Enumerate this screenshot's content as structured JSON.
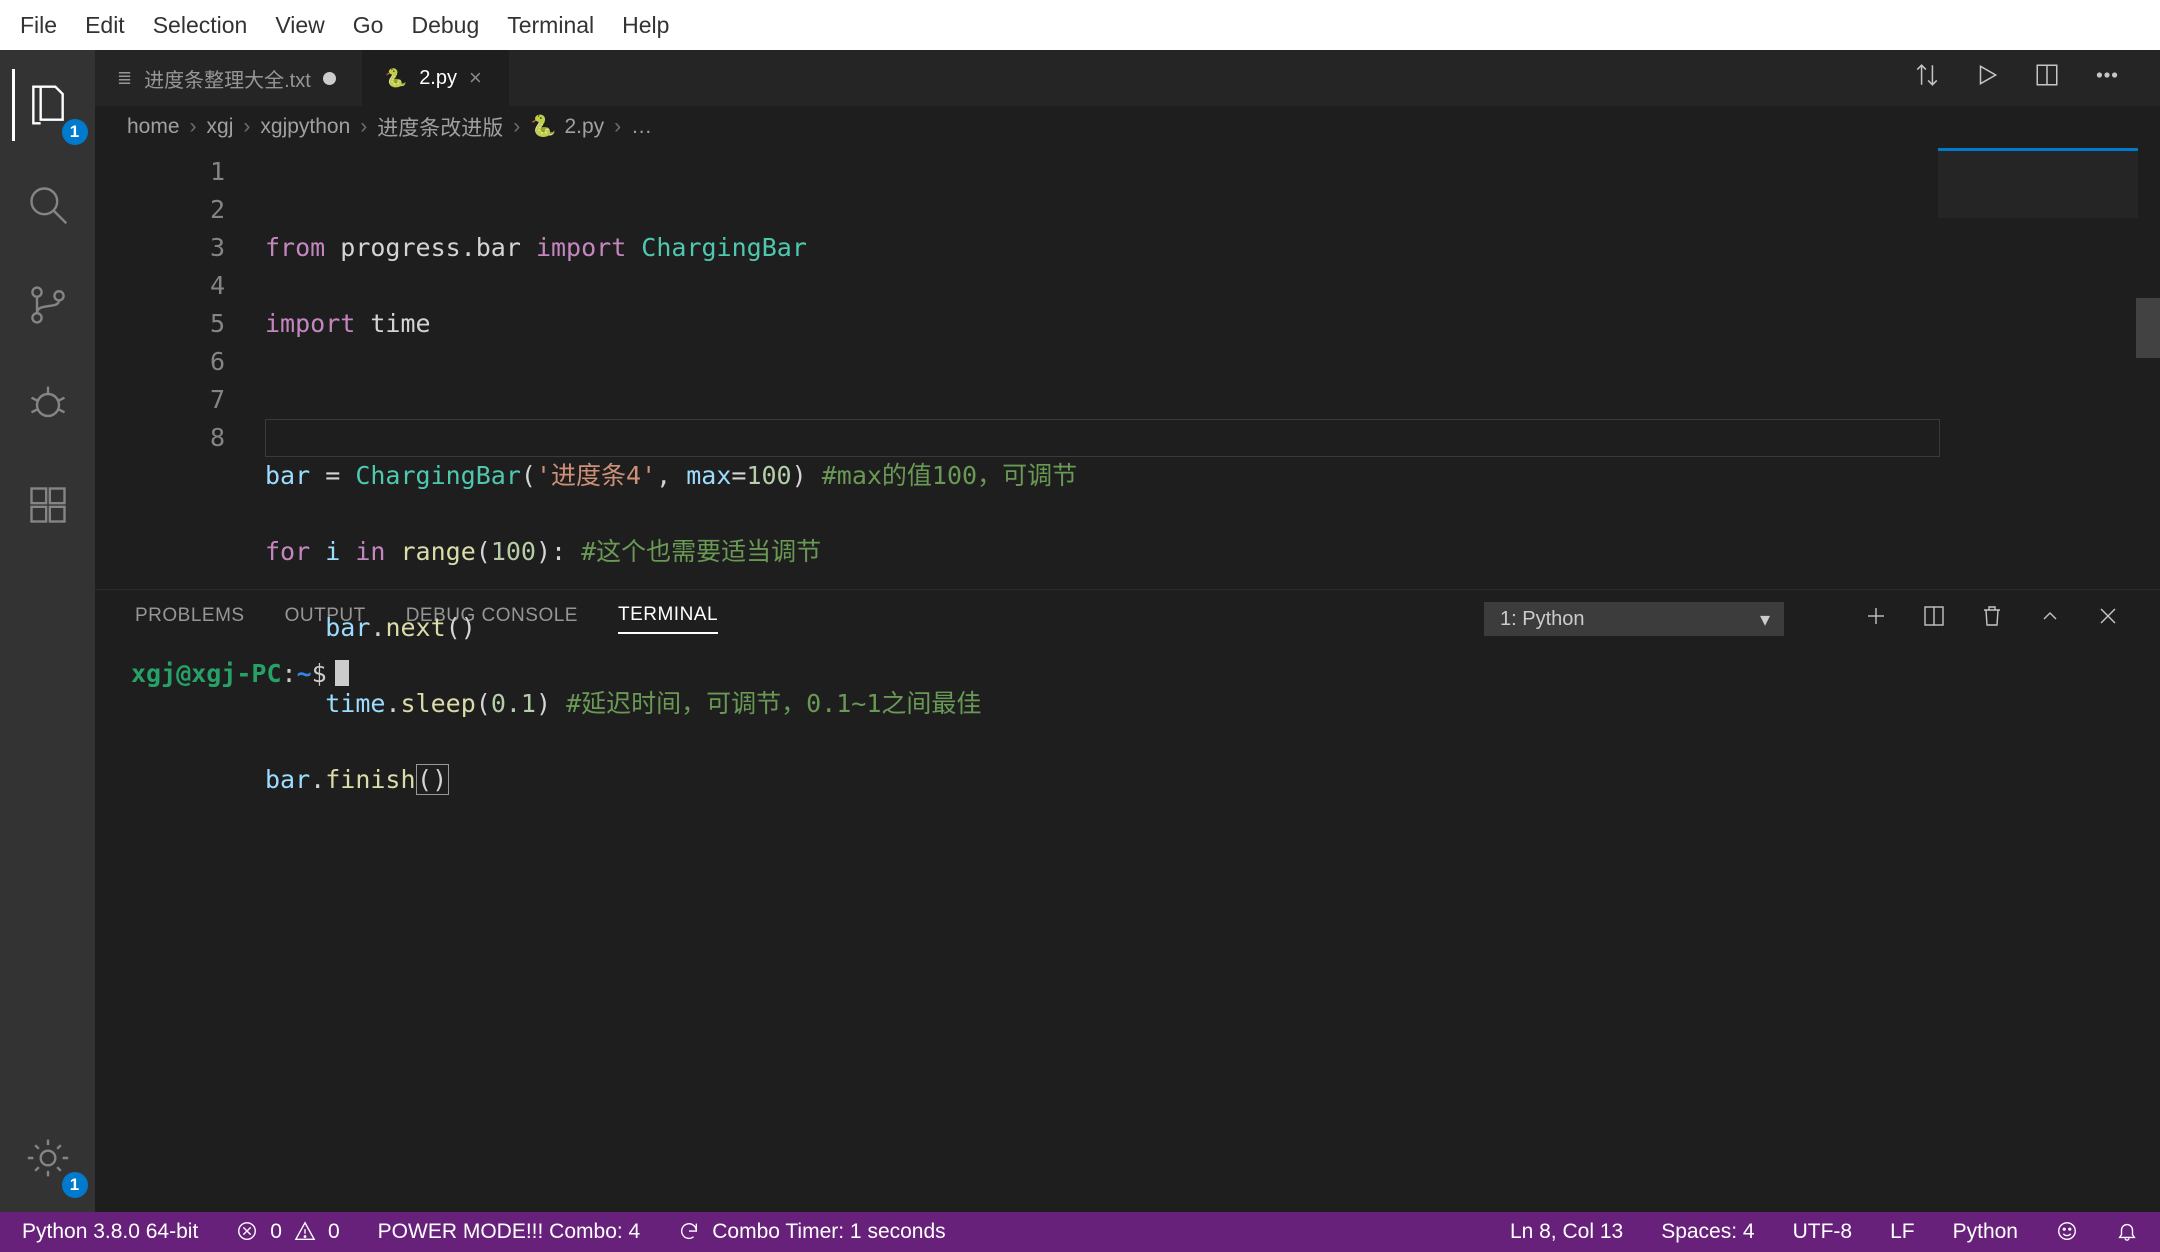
{
  "menubar": {
    "items": [
      "File",
      "Edit",
      "Selection",
      "View",
      "Go",
      "Debug",
      "Terminal",
      "Help"
    ]
  },
  "activitybar": {
    "explorer_badge": "1",
    "settings_badge": "1"
  },
  "tabs": [
    {
      "icon": "≣",
      "label": "进度条整理大全.txt",
      "dirty": true,
      "active": false
    },
    {
      "icon": "py",
      "label": "2.py",
      "dirty": false,
      "active": true
    }
  ],
  "breadcrumbs": [
    "home",
    "xgj",
    "xgjpython",
    "进度条改进版",
    "2.py",
    "…"
  ],
  "code": {
    "lines": [
      "1",
      "2",
      "3",
      "4",
      "5",
      "6",
      "7",
      "8"
    ],
    "l1_from": "from",
    "l1_mod": " progress.bar ",
    "l1_import": "import",
    "l1_cls": " ChargingBar",
    "l2_import": "import",
    "l2_mod": " time",
    "l4_var": "bar ",
    "l4_eq": "= ",
    "l4_cls": "ChargingBar",
    "l4_p1": "(",
    "l4_str": "'进度条4'",
    "l4_c1": ", ",
    "l4_kw": "max",
    "l4_eq2": "=",
    "l4_num": "100",
    "l4_p2": ") ",
    "l4_cmt": "#max的值100，可调节",
    "l5_for": "for",
    "l5_i": " i ",
    "l5_in": "in",
    "l5_sp": " ",
    "l5_range": "range",
    "l5_p1": "(",
    "l5_num": "100",
    "l5_p2": "): ",
    "l5_cmt": "#这个也需要适当调节",
    "l6_ind": "    ",
    "l6_obj": "bar",
    "l6_dot": ".",
    "l6_next": "next",
    "l6_pp": "()",
    "l7_ind": "    ",
    "l7_obj": "time",
    "l7_dot": ".",
    "l7_sleep": "sleep",
    "l7_p1": "(",
    "l7_num": "0.1",
    "l7_p2": ") ",
    "l7_cmt": "#延迟时间，可调节，0.1~1之间最佳",
    "l8_obj": "bar",
    "l8_dot": ".",
    "l8_fin": "finish",
    "l8_p1": "(",
    "l8_p2": ")"
  },
  "panel": {
    "tabs": [
      "PROBLEMS",
      "OUTPUT",
      "DEBUG CONSOLE",
      "TERMINAL"
    ],
    "active_tab": "TERMINAL",
    "terminal_selector": "1: Python",
    "prompt_user": "xgj@xgj-PC",
    "prompt_colon": ":",
    "prompt_path": "~",
    "prompt_dollar": "$"
  },
  "status": {
    "python": "Python 3.8.0 64-bit",
    "errors": "0",
    "warnings": "0",
    "power": "POWER MODE!!! Combo: 4",
    "combo": "Combo Timer: 1 seconds",
    "ln": "Ln 8, Col 13",
    "spaces": "Spaces: 4",
    "enc": "UTF-8",
    "eol": "LF",
    "lang": "Python"
  }
}
